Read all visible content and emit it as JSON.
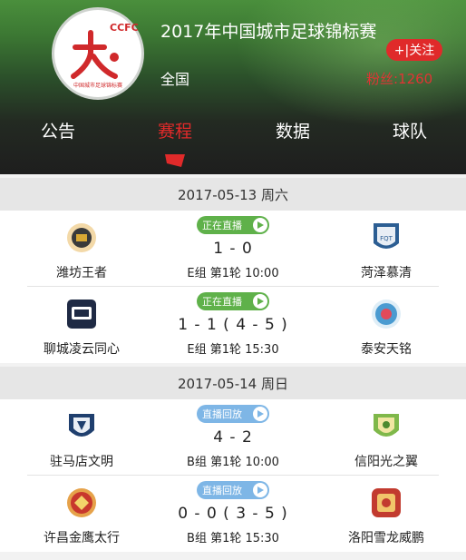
{
  "header": {
    "title": "2017年中国城市足球锦标赛",
    "region": "全国",
    "follow_label": "+|关注",
    "fans": "粉丝:1260",
    "logo_text": "CCFC",
    "logo_subtext": "中国城市足球锦标赛"
  },
  "tabs": [
    {
      "label": "公告",
      "active": false
    },
    {
      "label": "赛程",
      "active": true
    },
    {
      "label": "数据",
      "active": false
    },
    {
      "label": "球队",
      "active": false
    }
  ],
  "days": [
    {
      "date": "2017-05-13 周六",
      "matches": [
        {
          "status": "正在直播",
          "status_type": "live",
          "home": "潍坊王者",
          "away": "菏泽慕清",
          "score": "1 - 0",
          "info": "E组 第1轮 10:00"
        },
        {
          "status": "正在直播",
          "status_type": "live",
          "home": "聊城凌云同心",
          "away": "泰安天铭",
          "score": "1 - 1 ( 4 - 5 )",
          "info": "E组 第1轮 15:30"
        }
      ]
    },
    {
      "date": "2017-05-14 周日",
      "matches": [
        {
          "status": "直播回放",
          "status_type": "replay",
          "home": "驻马店文明",
          "away": "信阳光之翼",
          "score": "4 - 2",
          "info": "B组 第1轮 10:00"
        },
        {
          "status": "直播回放",
          "status_type": "replay",
          "home": "许昌金鹰太行",
          "away": "洛阳雪龙威鹏",
          "score": "0 - 0 ( 3 - 5 )",
          "info": "B组 第1轮 15:30"
        }
      ]
    }
  ],
  "colors": {
    "accent": "#e02a2a",
    "live": "#5fb14a",
    "replay": "#7eb6e6"
  }
}
